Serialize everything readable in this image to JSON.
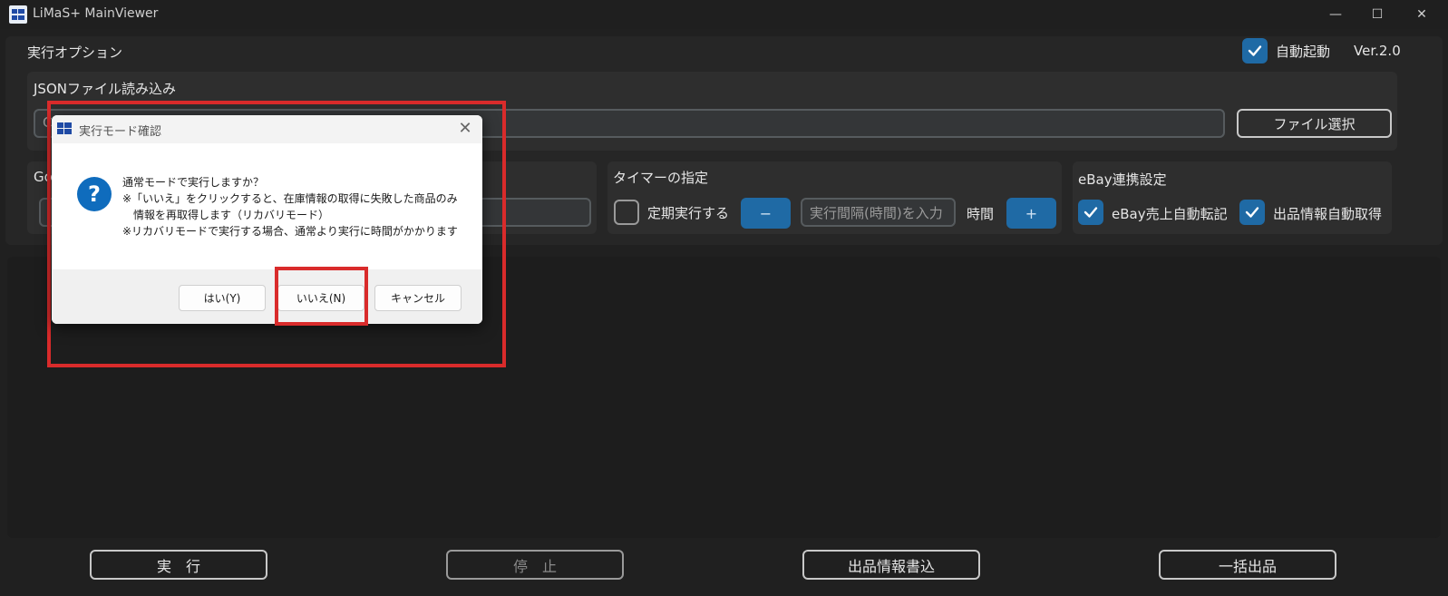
{
  "window": {
    "title": "LiMaS+ MainViewer",
    "minimize_glyph": "—",
    "maximize_glyph": "☐",
    "close_glyph": "✕"
  },
  "options": {
    "title": "実行オプション",
    "auto_start_label": "自動起動",
    "auto_start_checked": true,
    "version": "Ver.2.0"
  },
  "json_load": {
    "title": "JSONファイル読み込み",
    "path_partial": "C",
    "file_select_label": "ファイル選択"
  },
  "google": {
    "title_partial": "Go",
    "input_partial": "I"
  },
  "timer": {
    "title": "タイマーの指定",
    "periodic_label": "定期実行する",
    "periodic_checked": false,
    "minus_label": "−",
    "interval_placeholder": "実行間隔(時間)を入力",
    "unit_label": "時間",
    "plus_label": "+"
  },
  "ebay": {
    "title": "eBay連携設定",
    "sales_label": "eBay売上自動転記",
    "sales_checked": true,
    "listing_label": "出品情報自動取得",
    "listing_checked": true
  },
  "bottom": {
    "run_label": "実　行",
    "stop_label": "停　止",
    "write_label": "出品情報書込",
    "bulk_label": "一括出品"
  },
  "dialog": {
    "title": "実行モード確認",
    "close_glyph": "✕",
    "icon_glyph": "?",
    "message_lines": [
      "通常モードで実行しますか？",
      "※「いいえ」をクリックすると、在庫情報の取得に失敗した商品のみ",
      "　情報を再取得します（リカバリモード）",
      "※リカバリモードで実行する場合、通常より実行に時間がかかります"
    ],
    "yes_label": "はい(Y)",
    "no_label": "いいえ(N)",
    "cancel_label": "キャンセル"
  },
  "colors": {
    "accent": "#1f6aa5",
    "highlight": "#d92b2b",
    "info_icon": "#0f6cbd"
  }
}
